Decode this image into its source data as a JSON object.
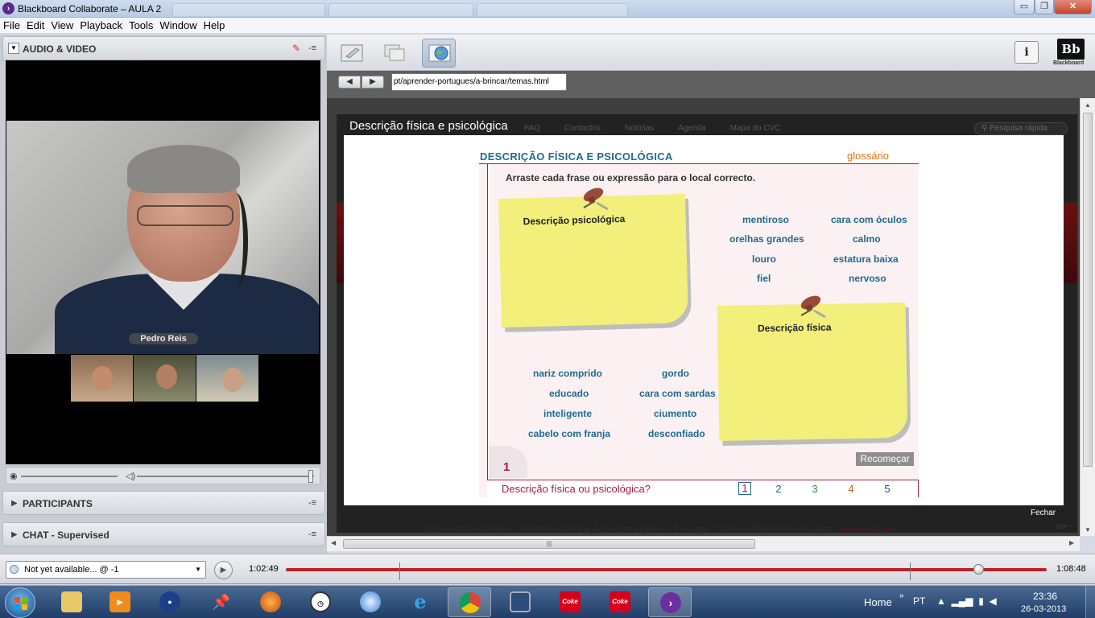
{
  "window": {
    "title": "Blackboard Collaborate – AULA 2",
    "buttons": {
      "minimize": "▭",
      "maximize": "❐",
      "close": "✕"
    }
  },
  "menu": [
    "File",
    "Edit",
    "View",
    "Playback",
    "Tools",
    "Window",
    "Help"
  ],
  "panels": {
    "audio_video": "AUDIO & VIDEO",
    "participants": "PARTICIPANTS",
    "chat": "CHAT - Supervised",
    "options_glyph": "-≡"
  },
  "video": {
    "speaker_name": "Pedro Reis"
  },
  "toolbar": {
    "bb_logo_text": "Bb",
    "bb_logo_word": "Blackboard",
    "info_label": "i"
  },
  "address": {
    "url": "pt/aprender-portugues/a-brincar/temas.html"
  },
  "website_bg": {
    "nav": [
      "FAQ",
      "Contactos",
      "Notícias",
      "Agenda",
      "Mapa do CVC"
    ],
    "search_placeholder": "Pesquisa rápida",
    "footer": "2010 Instituto Camões - Ministério dos Negócios Estrangeiros - Portugal - Todos os Direitos Reservados -",
    "footer_legal": "Avisos Legais",
    "top_link": "TOP ^"
  },
  "popup": {
    "title": "Descrição física e psicológica",
    "close_label": "Fechar"
  },
  "exercise": {
    "heading": "DESCRIÇÃO FÍSICA E PSICOLÓGICA",
    "glossary_link": "glossário",
    "instruction": "Arraste cada frase ou expressão para o local correcto.",
    "note_psych_label": "Descrição psicológica",
    "note_phys_label": "Descrição física",
    "words_right_col1": [
      "mentiroso",
      "orelhas grandes",
      "louro",
      "fiel"
    ],
    "words_right_col2": [
      "cara com óculos",
      "calmo",
      "estatura baixa",
      "nervoso"
    ],
    "words_bottom_col1": [
      "nariz comprido",
      "educado",
      "inteligente",
      "cabelo com franja"
    ],
    "words_bottom_col2": [
      "gordo",
      "cara com sardas",
      "ciumento",
      "desconfiado"
    ],
    "page_number": "1",
    "restart_button": "Recomeçar",
    "bottom_title": "Descrição física ou psicológica?",
    "pages": [
      "1",
      "2",
      "3",
      "4",
      "5"
    ],
    "page_colors": [
      "#b01a3a",
      "#1f6b8f",
      "#2e8b2e",
      "#c0601a",
      "#1f4f8f"
    ]
  },
  "playback": {
    "dropdown_value": "Not yet available... @ -1",
    "current_time": "1:02:49",
    "end_time": "1:08:48",
    "progress": 0.91,
    "play_glyph": "▶"
  },
  "taskbar": {
    "home_label": "Home",
    "language": "PT",
    "time": "23:36",
    "date": "26-03-2013",
    "apps": [
      "explorer",
      "media-player",
      "user",
      "pushpin",
      "firefox",
      "clock",
      "safari",
      "internet-explorer",
      "chrome",
      "monitor",
      "coca-cola",
      "coca-cola",
      "blackboard-collaborate"
    ]
  },
  "colors": {
    "accent_red": "#b01a3a",
    "word_blue": "#1f6b8f",
    "gloss_orange": "#e07010",
    "note_yellow": "#f2ef7b",
    "progress_red": "#b7242a"
  }
}
